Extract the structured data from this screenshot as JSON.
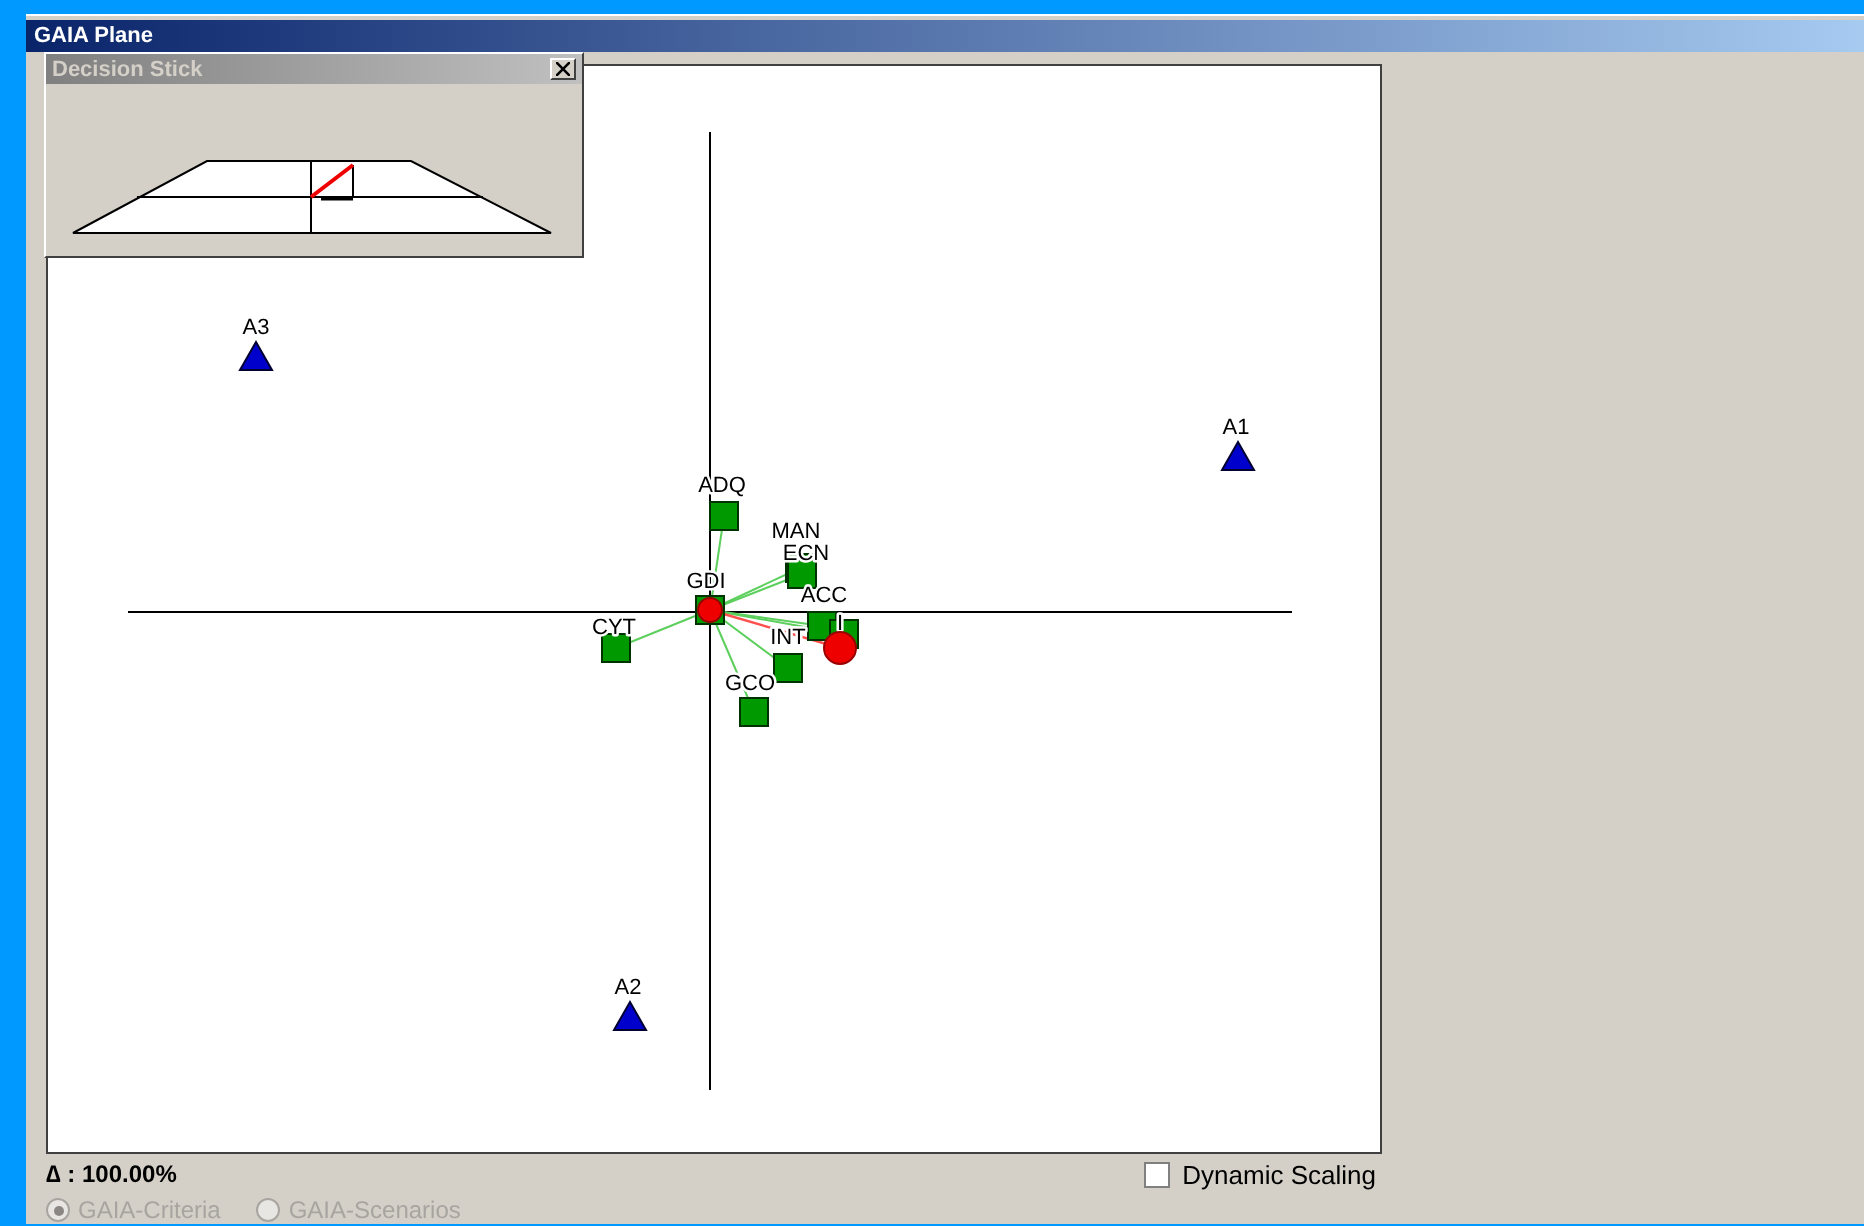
{
  "window": {
    "title": "GAIA Plane"
  },
  "decision_stick": {
    "title": "Decision Stick"
  },
  "plot": {
    "points": [
      {
        "kind": "alternative",
        "label": "A3"
      },
      {
        "kind": "alternative",
        "label": "A1"
      },
      {
        "kind": "alternative",
        "label": "A2"
      },
      {
        "kind": "criterion",
        "label": "ADQ"
      },
      {
        "kind": "criterion",
        "label": "MAN"
      },
      {
        "kind": "criterion",
        "label": "ECN"
      },
      {
        "kind": "criterion",
        "label": "GDI"
      },
      {
        "kind": "criterion",
        "label": "ACC"
      },
      {
        "kind": "criterion",
        "label": "I"
      },
      {
        "kind": "criterion",
        "label": "CYT"
      },
      {
        "kind": "criterion",
        "label": "INT"
      },
      {
        "kind": "criterion",
        "label": "GCO"
      }
    ]
  },
  "delta": "∆ : 100.00%",
  "view_options": [
    {
      "label": "GAIA-Criteria",
      "selected": true,
      "disabled": true
    },
    {
      "label": "GAIA-Scenarios",
      "selected": false,
      "disabled": true
    }
  ],
  "dynamic_scaling": {
    "label": "Dynamic Scaling",
    "checked": false
  }
}
